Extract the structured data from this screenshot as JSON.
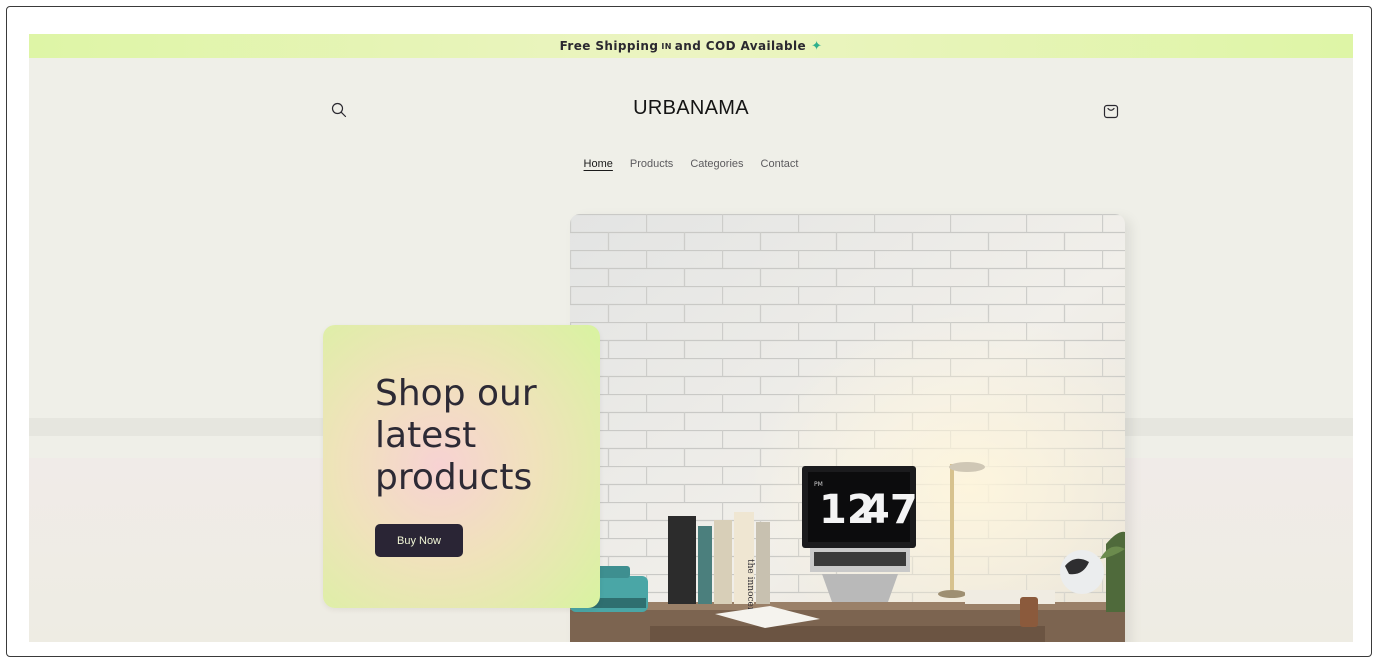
{
  "announcement": {
    "text_before": "Free Shipping",
    "flag": "IN",
    "text_after": "and COD Available",
    "gem_icon": "sparkle-gem-icon"
  },
  "header": {
    "logo": "URBANAMA",
    "search_icon": "search-icon",
    "cart_icon": "cart-icon"
  },
  "nav": {
    "items": [
      {
        "label": "Home",
        "active": true
      },
      {
        "label": "Products",
        "active": false
      },
      {
        "label": "Categories",
        "active": false
      },
      {
        "label": "Contact",
        "active": false
      }
    ]
  },
  "hero": {
    "clock": {
      "small": "PM",
      "hour": "12",
      "minute": "47"
    },
    "book_spine": "the innocents"
  },
  "promo": {
    "title_line1": "Shop our",
    "title_line2": "latest",
    "title_line3": "products",
    "button_label": "Buy Now"
  },
  "colors": {
    "announcement_bg": "#def5a6",
    "page_bg": "#efefe8",
    "button_bg": "#2a2535",
    "button_text": "#f1f6d6",
    "card_gradient_edge": "#d8f3a0",
    "card_gradient_center": "#f7d2d3"
  }
}
